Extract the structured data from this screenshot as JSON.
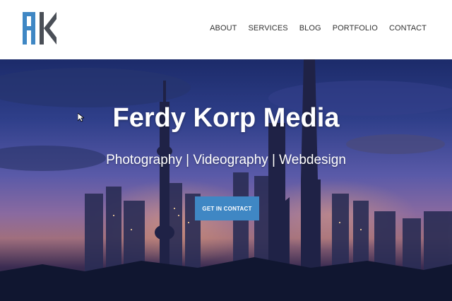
{
  "header": {
    "logo_alt": "FK",
    "nav": [
      {
        "label": "ABOUT"
      },
      {
        "label": "SERVICES"
      },
      {
        "label": "BLOG"
      },
      {
        "label": "PORTFOLIO"
      },
      {
        "label": "CONTACT"
      }
    ]
  },
  "hero": {
    "title": "Ferdy Korp Media",
    "subtitle": "Photography | Videography | Webdesign",
    "cta_label": "GET IN CONTACT"
  },
  "colors": {
    "brand_blue": "#3f87c4",
    "logo_dark": "#4a4f57",
    "nav_text": "#333333"
  }
}
